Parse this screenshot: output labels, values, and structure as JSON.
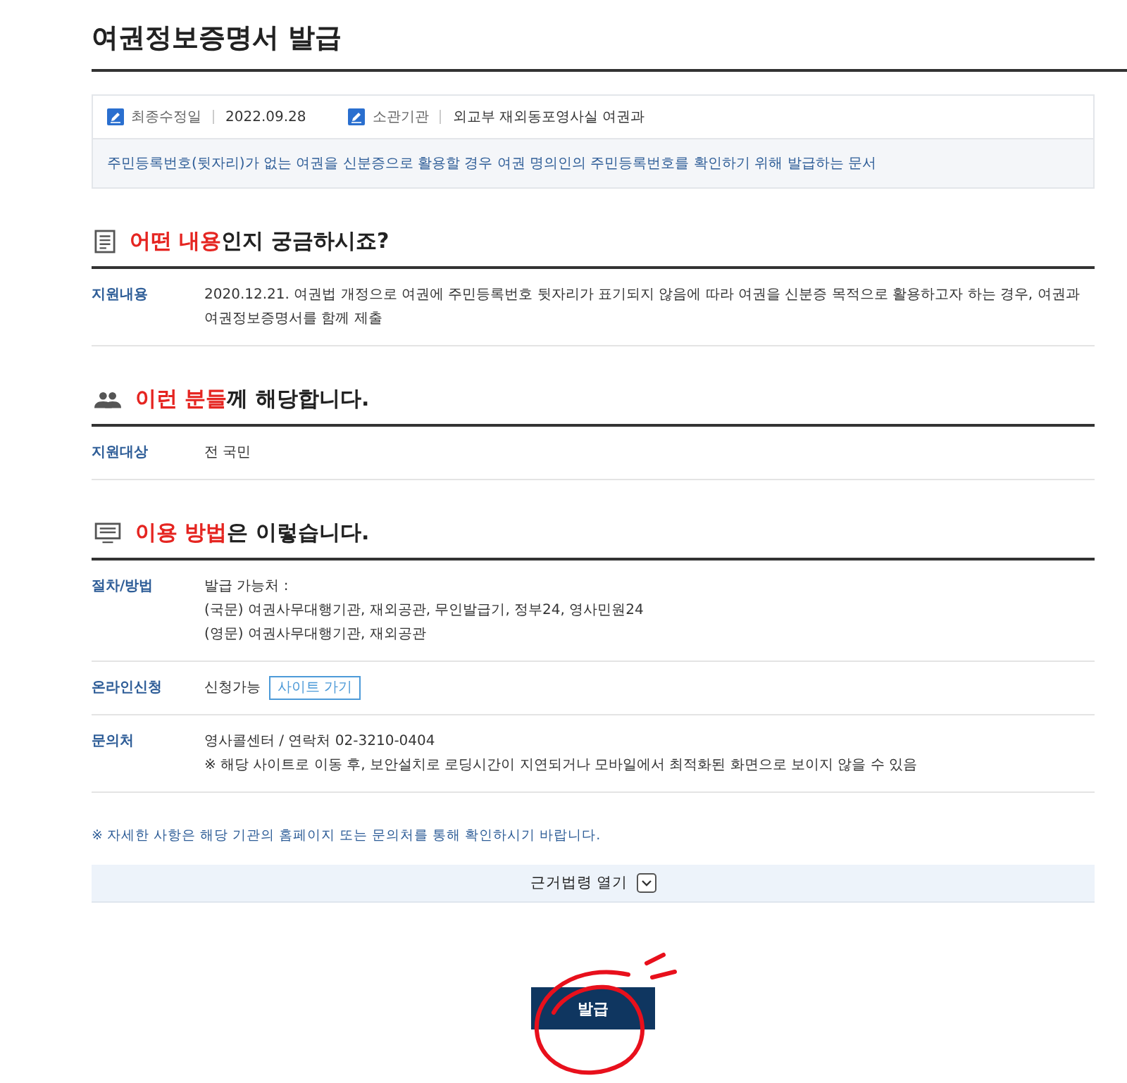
{
  "page_title": "여권정보증명서 발급",
  "meta": [
    {
      "label": "최종수정일",
      "value": "2022.09.28"
    },
    {
      "label": "소관기관",
      "value": "외교부 재외동포영사실 여권과"
    }
  ],
  "summary": "주민등록번호(뒷자리)가 없는 여권을 신분증으로 활용할 경우 여권 명의인의 주민등록번호를 확인하기 위해 발급하는 문서",
  "sections": [
    {
      "kind": "document",
      "highlight": "어떤 내용",
      "rest": "인지 궁금하시죠?",
      "rows": [
        {
          "label": "지원내용",
          "lines": [
            "2020.12.21. 여권법 개정으로 여권에 주민등록번호 뒷자리가 표기되지 않음에 따라 여권을 신분증 목적으로 활용하고자 하는 경우, 여권과 여권정보증명서를 함께 제출"
          ]
        }
      ]
    },
    {
      "kind": "people",
      "highlight": "이런 분들",
      "rest": "께 해당합니다.",
      "rows": [
        {
          "label": "지원대상",
          "lines": [
            "전 국민"
          ]
        }
      ]
    },
    {
      "kind": "monitor",
      "highlight": "이용 방법",
      "rest": "은 이렇습니다.",
      "rows": [
        {
          "label": "절차/방법",
          "lines": [
            "발급 가능처 :",
            "(국문) 여권사무대행기관, 재외공관, 무인발급기, 정부24, 영사민원24",
            "(영문) 여권사무대행기관, 재외공관"
          ]
        },
        {
          "label": "온라인신청",
          "lines": [
            "신청가능"
          ],
          "link": "사이트 가기"
        },
        {
          "label": "문의처",
          "lines": [
            "영사콜센터 / 연락처 02-3210-0404",
            "※ 해당 사이트로 이동 후, 보안설치로 로딩시간이 지연되거나 모바일에서 최적화된 화면으로 보이지 않을 수 있음"
          ]
        }
      ]
    }
  ],
  "notice": "※ 자세한 사항은 해당 기관의 홈페이지 또는 문의처를 통해 확인하시기 바랍니다.",
  "law_toggle": {
    "label": "근거법령 열기",
    "expanded": false
  },
  "issue_button": "발급"
}
